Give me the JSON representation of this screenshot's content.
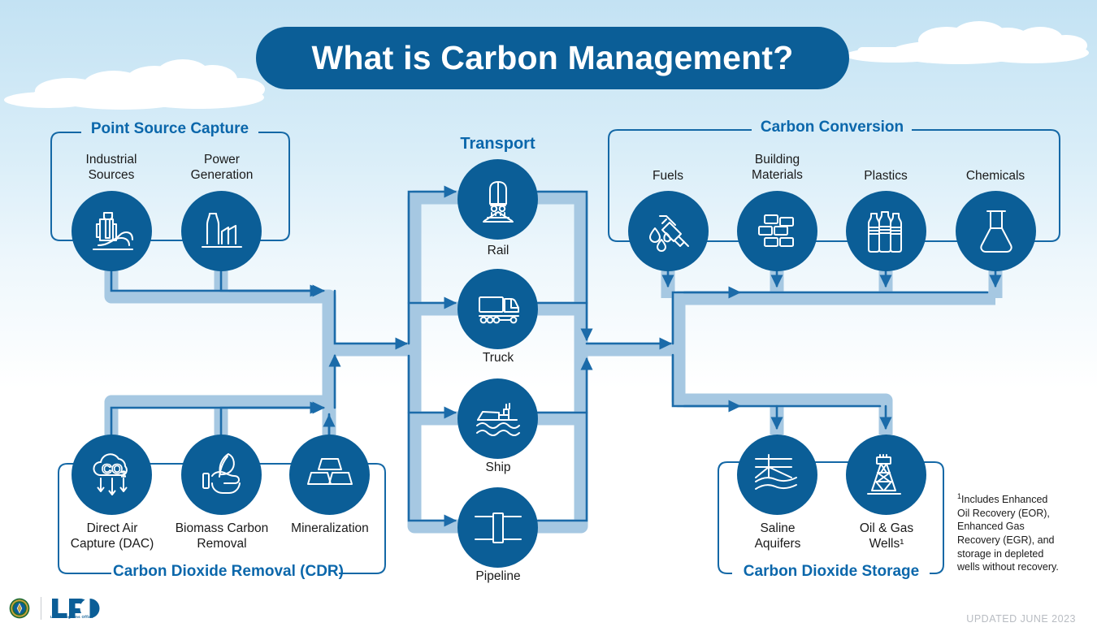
{
  "page": {
    "title": "What is Carbon Management?",
    "updated": "UPDATED JUNE 2023"
  },
  "colors": {
    "brand_blue": "#0b5e97",
    "title_blue": "#0b67ab",
    "pipe_light": "#a6c8e2",
    "pipe_line": "#1b6ba9",
    "sky_top": "#c3e2f3",
    "footer_gray": "#b8bcc2"
  },
  "groups": {
    "point_source": {
      "title": "Point Source Capture",
      "nodes": [
        {
          "label": "Industrial\nSources",
          "icon": "industrial-sources-icon"
        },
        {
          "label": "Power\nGeneration",
          "icon": "power-generation-icon"
        }
      ]
    },
    "transport": {
      "title": "Transport",
      "nodes": [
        {
          "label": "Rail",
          "icon": "rail-icon"
        },
        {
          "label": "Truck",
          "icon": "truck-icon"
        },
        {
          "label": "Ship",
          "icon": "ship-icon"
        },
        {
          "label": "Pipeline",
          "icon": "pipeline-icon"
        }
      ]
    },
    "carbon_conversion": {
      "title": "Carbon Conversion",
      "nodes": [
        {
          "label": "Fuels",
          "icon": "fuel-nozzle-icon"
        },
        {
          "label": "Building\nMaterials",
          "icon": "bricks-icon"
        },
        {
          "label": "Plastics",
          "icon": "bottles-icon"
        },
        {
          "label": "Chemicals",
          "icon": "flask-icon"
        }
      ]
    },
    "cdr": {
      "title": "Carbon Dioxide Removal (CDR)",
      "nodes": [
        {
          "label": "Direct Air\nCapture (DAC)",
          "icon": "co2-cloud-icon"
        },
        {
          "label": "Biomass Carbon\nRemoval",
          "icon": "hand-leaf-icon"
        },
        {
          "label": "Mineralization",
          "icon": "mineral-blocks-icon"
        }
      ]
    },
    "storage": {
      "title": "Carbon Dioxide Storage",
      "nodes": [
        {
          "label": "Saline\nAquifers",
          "icon": "aquifer-icon"
        },
        {
          "label": "Oil & Gas\nWells¹",
          "icon": "oil-derrick-icon"
        }
      ]
    }
  },
  "footnote": {
    "marker": "1",
    "text": "Includes Enhanced Oil Recovery (EOR), Enhanced Gas Recovery (EGR), and storage in depleted wells without recovery."
  },
  "footer": {
    "seal": "doe-seal-icon",
    "logo": "LPO",
    "logo_sub": "Loan Programs Office"
  }
}
